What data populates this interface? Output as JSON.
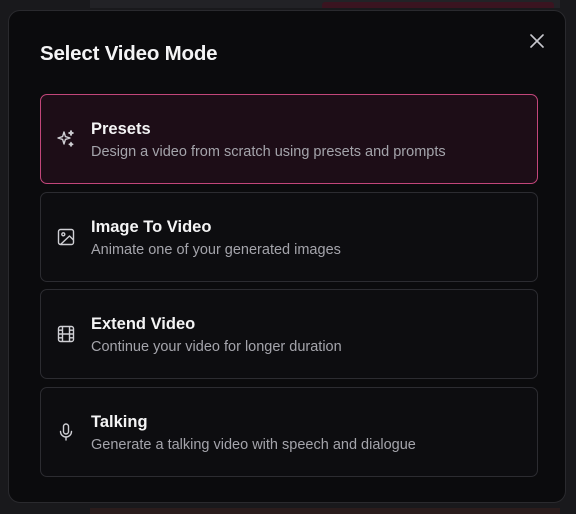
{
  "modal": {
    "title": "Select Video Mode",
    "close_icon": "close-icon",
    "options": [
      {
        "icon": "sparkles-icon",
        "title": "Presets",
        "description": "Design a video from scratch using presets and prompts",
        "selected": true
      },
      {
        "icon": "image-icon",
        "title": "Image To Video",
        "description": "Animate one of your generated images",
        "selected": false
      },
      {
        "icon": "film-icon",
        "title": "Extend Video",
        "description": "Continue your video for longer duration",
        "selected": false
      },
      {
        "icon": "microphone-icon",
        "title": "Talking",
        "description": "Generate a talking video with speech and dialogue",
        "selected": false
      }
    ]
  },
  "colors": {
    "accent": "#c2467a",
    "selected_bg": "#1d0d17",
    "modal_bg": "#0b0b0d",
    "text_primary": "#f4f4f5",
    "text_secondary": "#a4a4ab"
  }
}
